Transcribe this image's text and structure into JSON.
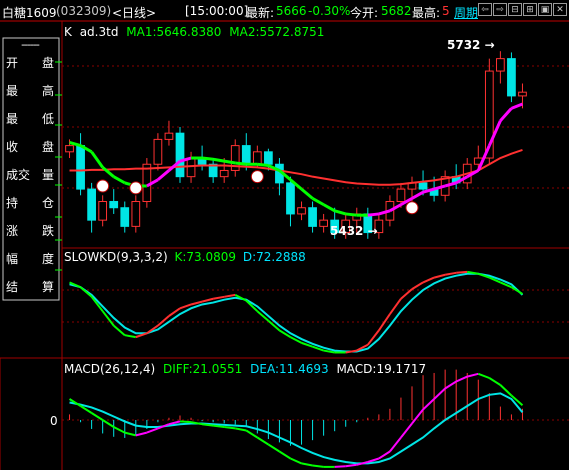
{
  "titlebar": {
    "symbol": "白糖1609",
    "code": "(032309)",
    "period": "<日线>",
    "time": "[15:00:00]",
    "latest_label": "最新:",
    "latest_value": "5666",
    "change": "-0.30%",
    "open_label": "今开:",
    "open_value": "5682",
    "high_label": "最高:",
    "high_value": "5",
    "week_label": "周期",
    "buttons": [
      "⇦",
      "⇨",
      "⊟",
      "⊞",
      "▣",
      "✕"
    ]
  },
  "menu": {
    "title": "------",
    "items": [
      {
        "a": "开",
        "b": "盘"
      },
      {
        "a": "最",
        "b": "高"
      },
      {
        "a": "最",
        "b": "低"
      },
      {
        "a": "收",
        "b": "盘"
      },
      {
        "a": "成交",
        "b": "量"
      },
      {
        "a": "持",
        "b": "仓"
      },
      {
        "a": "涨",
        "b": "跌"
      },
      {
        "a": "幅",
        "b": "度"
      },
      {
        "a": "结",
        "b": "算"
      }
    ]
  },
  "main_panel": {
    "label_k": "K",
    "label_ind": "ad.3td",
    "ma1": "MA1:5646.8380",
    "ma2": "MA2:5572.8751",
    "high_annotation": "5732",
    "low_annotation": "5432"
  },
  "kd_panel": {
    "name": "SLOWKD(9,3,3,2)",
    "k": "K:73.0809",
    "d": "D:72.2888"
  },
  "macd_panel": {
    "name": "MACD(26,12,4)",
    "diff": "DIFF:21.0551",
    "dea": "DEA:11.4693",
    "macd": "MACD:19.1717",
    "zero_label": "0"
  },
  "colors": {
    "up": "#ff3232",
    "down": "#00e5e5",
    "ma1": "#00ff00",
    "ma2": "#ff3030",
    "accent_magenta": "#ff00ff",
    "grid_red": "#a00000",
    "text_yellow": "#ffff00",
    "text_green": "#00ff00",
    "text_cyan": "#00e5ff"
  },
  "chart_data": {
    "type": "candlestick",
    "price_range": [
      5420,
      5750
    ],
    "candles": [
      [
        5570,
        5590,
        5560,
        5580
      ],
      [
        5580,
        5600,
        5500,
        5510
      ],
      [
        5510,
        5520,
        5440,
        5460
      ],
      [
        5460,
        5500,
        5450,
        5490
      ],
      [
        5490,
        5510,
        5470,
        5480
      ],
      [
        5480,
        5490,
        5440,
        5450
      ],
      [
        5450,
        5500,
        5440,
        5490
      ],
      [
        5490,
        5560,
        5480,
        5550
      ],
      [
        5550,
        5600,
        5540,
        5590
      ],
      [
        5590,
        5620,
        5580,
        5600
      ],
      [
        5600,
        5610,
        5520,
        5530
      ],
      [
        5530,
        5570,
        5520,
        5560
      ],
      [
        5560,
        5580,
        5540,
        5550
      ],
      [
        5550,
        5560,
        5520,
        5530
      ],
      [
        5530,
        5560,
        5520,
        5540
      ],
      [
        5540,
        5590,
        5530,
        5580
      ],
      [
        5580,
        5600,
        5540,
        5550
      ],
      [
        5550,
        5580,
        5545,
        5570
      ],
      [
        5570,
        5575,
        5540,
        5550
      ],
      [
        5550,
        5560,
        5500,
        5520
      ],
      [
        5520,
        5530,
        5450,
        5470
      ],
      [
        5470,
        5490,
        5460,
        5480
      ],
      [
        5480,
        5490,
        5440,
        5450
      ],
      [
        5450,
        5470,
        5440,
        5460
      ],
      [
        5460,
        5480,
        5430,
        5440
      ],
      [
        5440,
        5470,
        5430,
        5460
      ],
      [
        5460,
        5480,
        5440,
        5470
      ],
      [
        5470,
        5480,
        5430,
        5440
      ],
      [
        5440,
        5470,
        5430,
        5460
      ],
      [
        5460,
        5500,
        5450,
        5490
      ],
      [
        5490,
        5520,
        5480,
        5510
      ],
      [
        5510,
        5530,
        5490,
        5520
      ],
      [
        5520,
        5540,
        5500,
        5510
      ],
      [
        5510,
        5530,
        5490,
        5500
      ],
      [
        5500,
        5540,
        5490,
        5530
      ],
      [
        5530,
        5550,
        5510,
        5520
      ],
      [
        5520,
        5560,
        5510,
        5550
      ],
      [
        5550,
        5580,
        5540,
        5560
      ],
      [
        5560,
        5720,
        5550,
        5700
      ],
      [
        5700,
        5732,
        5680,
        5720
      ],
      [
        5720,
        5730,
        5650,
        5660
      ],
      [
        5660,
        5680,
        5640,
        5666
      ]
    ],
    "ma1": [
      5585,
      5580,
      5570,
      5545,
      5530,
      5520,
      5515,
      5515,
      5525,
      5540,
      5555,
      5560,
      5560,
      5558,
      5555,
      5552,
      5550,
      5550,
      5548,
      5540,
      5525,
      5510,
      5495,
      5485,
      5475,
      5470,
      5468,
      5468,
      5470,
      5475,
      5485,
      5495,
      5505,
      5510,
      5515,
      5520,
      5530,
      5540,
      5580,
      5620,
      5640,
      5647
    ],
    "ma2": [
      5540,
      5540,
      5541,
      5541,
      5542,
      5542,
      5543,
      5543,
      5544,
      5545,
      5546,
      5547,
      5548,
      5548,
      5548,
      5547,
      5546,
      5545,
      5543,
      5540,
      5537,
      5534,
      5530,
      5527,
      5524,
      5521,
      5519,
      5518,
      5517,
      5517,
      5518,
      5520,
      5522,
      5524,
      5527,
      5530,
      5535,
      5540,
      5550,
      5560,
      5567,
      5573
    ],
    "slowkd_k": [
      85,
      80,
      70,
      55,
      40,
      30,
      28,
      32,
      40,
      50,
      58,
      62,
      65,
      68,
      70,
      72,
      66,
      55,
      45,
      35,
      28,
      22,
      18,
      14,
      12,
      12,
      14,
      20,
      35,
      52,
      68,
      78,
      85,
      90,
      93,
      95,
      96,
      94,
      90,
      85,
      80,
      73
    ],
    "slowkd_d": [
      83,
      80,
      72,
      60,
      48,
      38,
      32,
      32,
      36,
      44,
      52,
      58,
      62,
      64,
      67,
      69,
      67,
      60,
      50,
      40,
      32,
      26,
      21,
      17,
      14,
      13,
      13,
      16,
      26,
      40,
      55,
      67,
      77,
      84,
      89,
      92,
      94,
      94,
      92,
      88,
      83,
      72
    ],
    "macd_diff": [
      30,
      20,
      10,
      0,
      -10,
      -18,
      -22,
      -18,
      -12,
      -6,
      -2,
      -3,
      -6,
      -8,
      -10,
      -12,
      -15,
      -25,
      -35,
      -45,
      -55,
      -62,
      -65,
      -67,
      -67,
      -66,
      -64,
      -60,
      -55,
      -45,
      -25,
      -5,
      15,
      30,
      45,
      55,
      62,
      66,
      60,
      50,
      35,
      21
    ],
    "macd_dea": [
      25,
      22,
      18,
      12,
      5,
      -2,
      -8,
      -10,
      -10,
      -8,
      -6,
      -5,
      -5,
      -6,
      -7,
      -8,
      -9,
      -13,
      -18,
      -25,
      -32,
      -40,
      -47,
      -53,
      -57,
      -60,
      -62,
      -62,
      -60,
      -55,
      -45,
      -35,
      -25,
      -12,
      0,
      10,
      20,
      30,
      36,
      38,
      30,
      11
    ]
  }
}
